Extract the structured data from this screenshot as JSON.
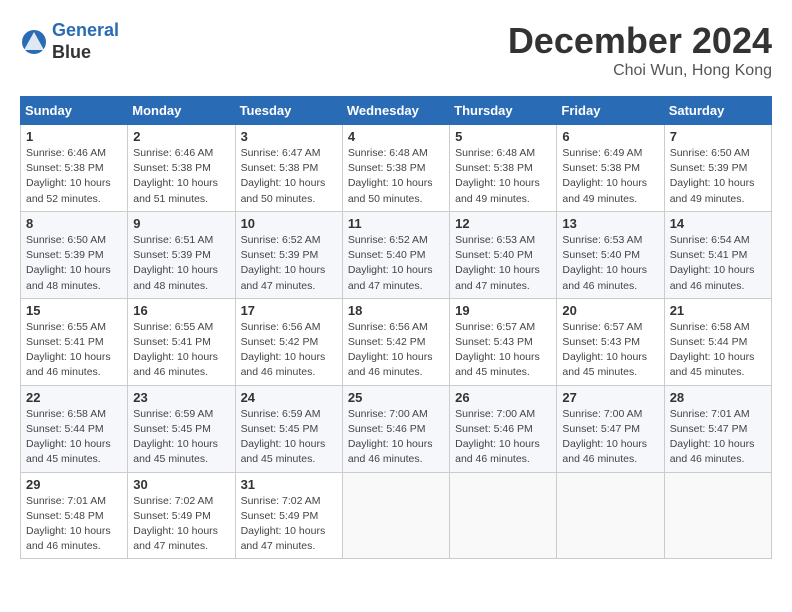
{
  "header": {
    "logo_line1": "General",
    "logo_line2": "Blue",
    "month_title": "December 2024",
    "location": "Choi Wun, Hong Kong"
  },
  "weekdays": [
    "Sunday",
    "Monday",
    "Tuesday",
    "Wednesday",
    "Thursday",
    "Friday",
    "Saturday"
  ],
  "weeks": [
    [
      {
        "day": "1",
        "info": "Sunrise: 6:46 AM\nSunset: 5:38 PM\nDaylight: 10 hours\nand 52 minutes."
      },
      {
        "day": "2",
        "info": "Sunrise: 6:46 AM\nSunset: 5:38 PM\nDaylight: 10 hours\nand 51 minutes."
      },
      {
        "day": "3",
        "info": "Sunrise: 6:47 AM\nSunset: 5:38 PM\nDaylight: 10 hours\nand 50 minutes."
      },
      {
        "day": "4",
        "info": "Sunrise: 6:48 AM\nSunset: 5:38 PM\nDaylight: 10 hours\nand 50 minutes."
      },
      {
        "day": "5",
        "info": "Sunrise: 6:48 AM\nSunset: 5:38 PM\nDaylight: 10 hours\nand 49 minutes."
      },
      {
        "day": "6",
        "info": "Sunrise: 6:49 AM\nSunset: 5:38 PM\nDaylight: 10 hours\nand 49 minutes."
      },
      {
        "day": "7",
        "info": "Sunrise: 6:50 AM\nSunset: 5:39 PM\nDaylight: 10 hours\nand 49 minutes."
      }
    ],
    [
      {
        "day": "8",
        "info": "Sunrise: 6:50 AM\nSunset: 5:39 PM\nDaylight: 10 hours\nand 48 minutes."
      },
      {
        "day": "9",
        "info": "Sunrise: 6:51 AM\nSunset: 5:39 PM\nDaylight: 10 hours\nand 48 minutes."
      },
      {
        "day": "10",
        "info": "Sunrise: 6:52 AM\nSunset: 5:39 PM\nDaylight: 10 hours\nand 47 minutes."
      },
      {
        "day": "11",
        "info": "Sunrise: 6:52 AM\nSunset: 5:40 PM\nDaylight: 10 hours\nand 47 minutes."
      },
      {
        "day": "12",
        "info": "Sunrise: 6:53 AM\nSunset: 5:40 PM\nDaylight: 10 hours\nand 47 minutes."
      },
      {
        "day": "13",
        "info": "Sunrise: 6:53 AM\nSunset: 5:40 PM\nDaylight: 10 hours\nand 46 minutes."
      },
      {
        "day": "14",
        "info": "Sunrise: 6:54 AM\nSunset: 5:41 PM\nDaylight: 10 hours\nand 46 minutes."
      }
    ],
    [
      {
        "day": "15",
        "info": "Sunrise: 6:55 AM\nSunset: 5:41 PM\nDaylight: 10 hours\nand 46 minutes."
      },
      {
        "day": "16",
        "info": "Sunrise: 6:55 AM\nSunset: 5:41 PM\nDaylight: 10 hours\nand 46 minutes."
      },
      {
        "day": "17",
        "info": "Sunrise: 6:56 AM\nSunset: 5:42 PM\nDaylight: 10 hours\nand 46 minutes."
      },
      {
        "day": "18",
        "info": "Sunrise: 6:56 AM\nSunset: 5:42 PM\nDaylight: 10 hours\nand 46 minutes."
      },
      {
        "day": "19",
        "info": "Sunrise: 6:57 AM\nSunset: 5:43 PM\nDaylight: 10 hours\nand 45 minutes."
      },
      {
        "day": "20",
        "info": "Sunrise: 6:57 AM\nSunset: 5:43 PM\nDaylight: 10 hours\nand 45 minutes."
      },
      {
        "day": "21",
        "info": "Sunrise: 6:58 AM\nSunset: 5:44 PM\nDaylight: 10 hours\nand 45 minutes."
      }
    ],
    [
      {
        "day": "22",
        "info": "Sunrise: 6:58 AM\nSunset: 5:44 PM\nDaylight: 10 hours\nand 45 minutes."
      },
      {
        "day": "23",
        "info": "Sunrise: 6:59 AM\nSunset: 5:45 PM\nDaylight: 10 hours\nand 45 minutes."
      },
      {
        "day": "24",
        "info": "Sunrise: 6:59 AM\nSunset: 5:45 PM\nDaylight: 10 hours\nand 45 minutes."
      },
      {
        "day": "25",
        "info": "Sunrise: 7:00 AM\nSunset: 5:46 PM\nDaylight: 10 hours\nand 46 minutes."
      },
      {
        "day": "26",
        "info": "Sunrise: 7:00 AM\nSunset: 5:46 PM\nDaylight: 10 hours\nand 46 minutes."
      },
      {
        "day": "27",
        "info": "Sunrise: 7:00 AM\nSunset: 5:47 PM\nDaylight: 10 hours\nand 46 minutes."
      },
      {
        "day": "28",
        "info": "Sunrise: 7:01 AM\nSunset: 5:47 PM\nDaylight: 10 hours\nand 46 minutes."
      }
    ],
    [
      {
        "day": "29",
        "info": "Sunrise: 7:01 AM\nSunset: 5:48 PM\nDaylight: 10 hours\nand 46 minutes."
      },
      {
        "day": "30",
        "info": "Sunrise: 7:02 AM\nSunset: 5:49 PM\nDaylight: 10 hours\nand 47 minutes."
      },
      {
        "day": "31",
        "info": "Sunrise: 7:02 AM\nSunset: 5:49 PM\nDaylight: 10 hours\nand 47 minutes."
      },
      {
        "day": "",
        "info": ""
      },
      {
        "day": "",
        "info": ""
      },
      {
        "day": "",
        "info": ""
      },
      {
        "day": "",
        "info": ""
      }
    ]
  ]
}
